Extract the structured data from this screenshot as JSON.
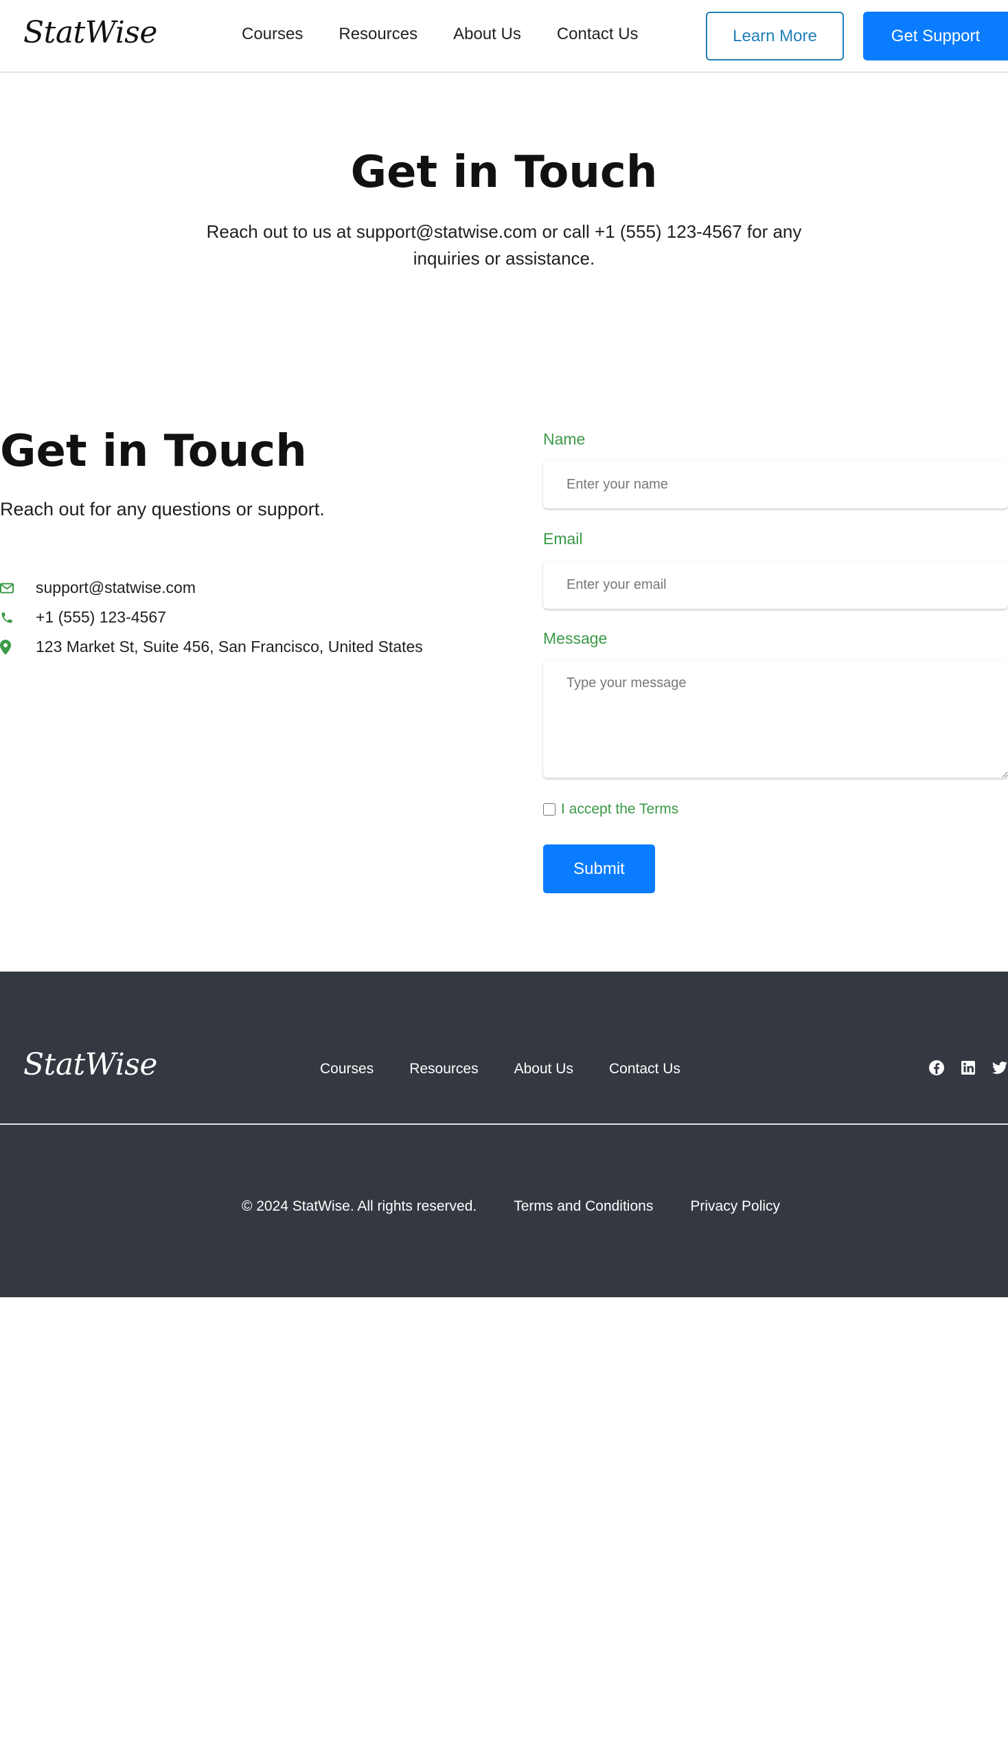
{
  "navbar": {
    "logo": "StatWise",
    "links": [
      {
        "label": "Courses"
      },
      {
        "label": "Resources"
      },
      {
        "label": "About Us"
      },
      {
        "label": "Contact Us"
      }
    ],
    "learn_more_label": "Learn More",
    "get_support_label": "Get Support"
  },
  "hero": {
    "title": "Get in Touch",
    "text": "Reach out to us at support@statwise.com or call +1 (555) 123-4567 for any inquiries or assistance."
  },
  "contact": {
    "title": "Get in Touch",
    "subtitle": "Reach out for any questions or support.",
    "email": "support@statwise.com",
    "phone": "+1 (555) 123-4567",
    "address": "123 Market St, Suite 456, San Francisco, United States"
  },
  "form": {
    "name_label": "Name",
    "name_placeholder": "Enter your name",
    "email_label": "Email",
    "email_placeholder": "Enter your email",
    "message_label": "Message",
    "message_placeholder": "Type your message",
    "terms_label": "I accept the Terms",
    "submit_label": "Submit"
  },
  "footer": {
    "logo": "StatWise",
    "links": [
      {
        "label": "Courses"
      },
      {
        "label": "Resources"
      },
      {
        "label": "About Us"
      },
      {
        "label": "Contact Us"
      }
    ],
    "social_icons": [
      "facebook-icon",
      "linkedin-icon",
      "twitter-icon"
    ],
    "copyright": "© 2024 StatWise. All rights reserved.",
    "terms_link": "Terms and Conditions",
    "privacy_link": "Privacy Policy"
  },
  "colors": {
    "accent_blue": "#0a7cff",
    "outline_blue": "#1f7fb6",
    "label_green": "#3a9a47",
    "footer_bg": "#343840"
  }
}
